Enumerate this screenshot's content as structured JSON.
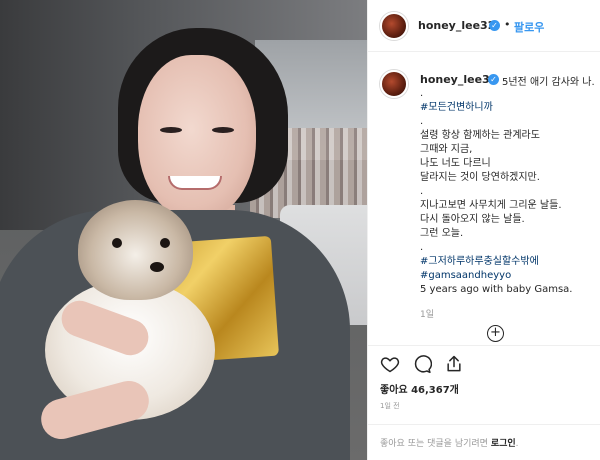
{
  "header": {
    "username": "honey_lee32",
    "follow_label": "팔로우",
    "separator": "•"
  },
  "caption": {
    "username": "honey_lee32",
    "first_line": "5년전 애기 감사와 나.",
    "lines": [
      ".",
      "#모든건변하니까",
      ".",
      "설령 항상 함께하는 관계라도",
      "그때와 지금,",
      "나도 너도 다르니",
      "달라지는 것이 당연하겠지만.",
      ".",
      "지나고보면 사무치게 그리운 날들.",
      "다시 돌아오지 않는 날들.",
      "그런 오늘.",
      ".",
      "#그저하루하루충실할수밖에",
      "#gamsaandheyyo",
      "5 years ago with baby Gamsa."
    ],
    "hashtag_flags": [
      false,
      true,
      false,
      false,
      false,
      false,
      false,
      false,
      false,
      false,
      false,
      false,
      true,
      true,
      false
    ],
    "time": "1일"
  },
  "actions": {
    "like_icon": "heart-icon",
    "comment_icon": "comment-icon",
    "share_icon": "share-icon",
    "more_icon": "plus-circle-icon",
    "more_symbol": "+"
  },
  "likes": {
    "label": "좋아요 46,367개"
  },
  "posted_ago": "1일 전",
  "login": {
    "prompt": "좋아요 또는 댓글을 남기려면 ",
    "link": "로그인",
    "suffix": "."
  },
  "colors": {
    "accent": "#3897f0",
    "hashtag": "#003569",
    "border": "#efefef",
    "muted": "#999999"
  }
}
